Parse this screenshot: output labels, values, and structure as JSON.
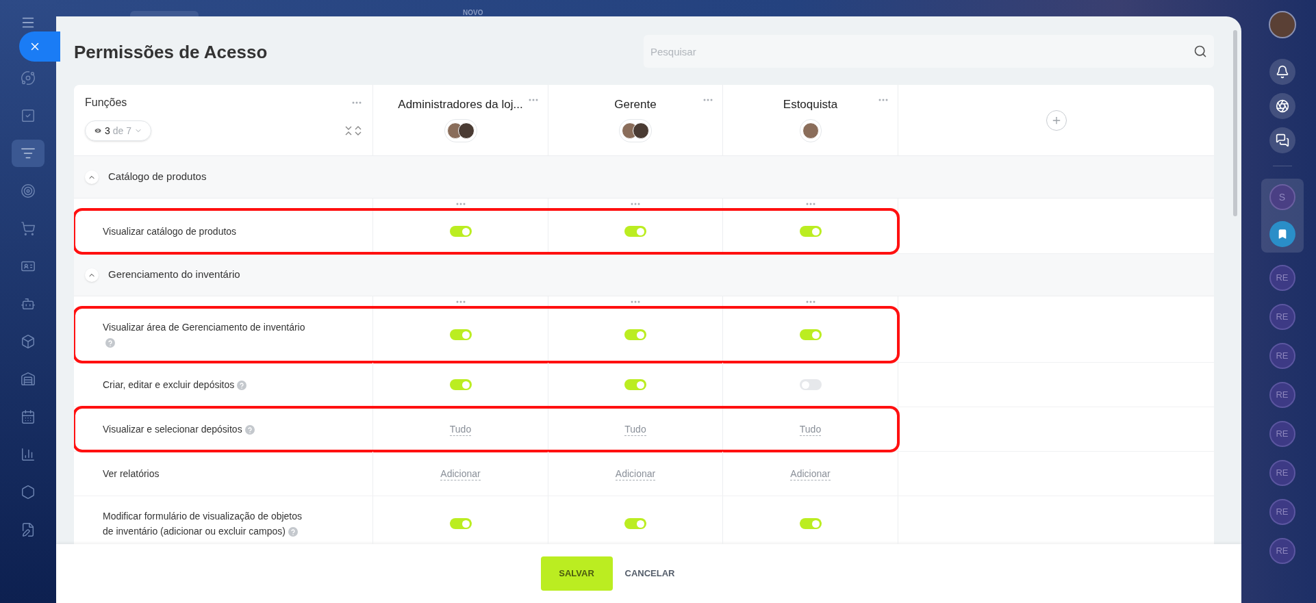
{
  "top_bar": {
    "badge": "NOVO"
  },
  "nav_items": [
    {
      "selected": false
    },
    {
      "selected": false
    },
    {
      "selected": true
    },
    {
      "selected": false
    },
    {
      "selected": false
    },
    {
      "selected": false
    },
    {
      "selected": false
    },
    {
      "selected": false
    },
    {
      "selected": false
    },
    {
      "selected": false
    },
    {
      "selected": false
    },
    {
      "selected": false
    },
    {
      "selected": false
    }
  ],
  "title": "Permissões de Acesso",
  "search": {
    "placeholder": "Pesquisar"
  },
  "roles_header": {
    "label": "Funções",
    "visible": "3",
    "total": "de 7"
  },
  "columns": [
    {
      "name": "Administradores da loj...",
      "members": [
        {
          "kind": "photo"
        },
        {
          "kind": "photo"
        }
      ]
    },
    {
      "name": "Gerente",
      "members": [
        {
          "kind": "photo"
        },
        {
          "kind": "photo"
        }
      ]
    },
    {
      "name": "Estoquista",
      "members": [
        {
          "kind": "photo"
        }
      ]
    }
  ],
  "sections": [
    {
      "title": "Catálogo de produtos",
      "expanded": true,
      "rows": [
        {
          "label": "Visualizar catálogo de produtos",
          "help": false,
          "highlighted": true,
          "cells": [
            {
              "kind": "toggle",
              "on": true
            },
            {
              "kind": "toggle",
              "on": true
            },
            {
              "kind": "toggle",
              "on": true
            }
          ]
        }
      ]
    },
    {
      "title": "Gerenciamento do inventário",
      "expanded": true,
      "rows": [
        {
          "label": "Visualizar área de Gerenciamento de inventário",
          "help": true,
          "highlighted": true,
          "cells": [
            {
              "kind": "toggle",
              "on": true
            },
            {
              "kind": "toggle",
              "on": true
            },
            {
              "kind": "toggle",
              "on": true
            }
          ]
        },
        {
          "label": "Criar, editar e excluir depósitos",
          "help": true,
          "highlighted": false,
          "cells": [
            {
              "kind": "toggle",
              "on": true
            },
            {
              "kind": "toggle",
              "on": true
            },
            {
              "kind": "toggle",
              "on": false
            }
          ]
        },
        {
          "label": "Visualizar e selecionar depósitos",
          "help": true,
          "highlighted": true,
          "cells": [
            {
              "kind": "link",
              "text": "Tudo"
            },
            {
              "kind": "link",
              "text": "Tudo"
            },
            {
              "kind": "link",
              "text": "Tudo"
            }
          ]
        },
        {
          "label": "Ver relatórios",
          "help": false,
          "highlighted": false,
          "cells": [
            {
              "kind": "link",
              "text": "Adicionar"
            },
            {
              "kind": "link",
              "text": "Adicionar"
            },
            {
              "kind": "link",
              "text": "Adicionar"
            }
          ]
        },
        {
          "label": "Modificar formulário de visualização de objetos de inventário (adicionar ou excluir campos)",
          "help": true,
          "highlighted": false,
          "cells": [
            {
              "kind": "toggle",
              "on": true
            },
            {
              "kind": "toggle",
              "on": true
            },
            {
              "kind": "toggle",
              "on": true
            }
          ]
        }
      ]
    }
  ],
  "footer": {
    "save": "SALVAR",
    "cancel": "CANCELAR"
  },
  "right_sidebar": {
    "pinned": [
      {
        "kind": "letter",
        "text": "S"
      },
      {
        "kind": "bookmark"
      }
    ],
    "chats": [
      "RE",
      "RE",
      "RE",
      "RE",
      "RE",
      "RE",
      "RE",
      "RE"
    ]
  }
}
